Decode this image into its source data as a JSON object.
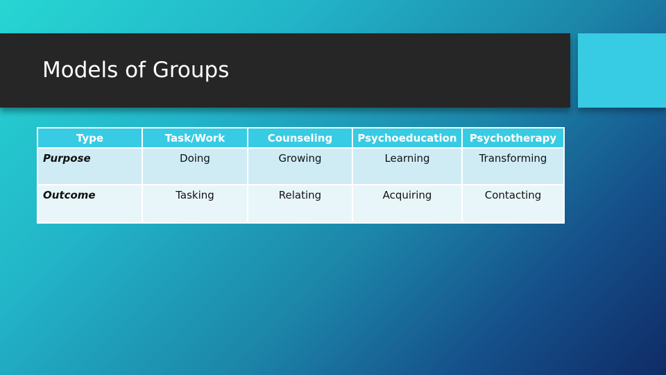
{
  "slide": {
    "title": "Models of Groups",
    "colors": {
      "title_bar": "#262626",
      "accent": "#38cbe4",
      "row_odd": "#cfecf5",
      "row_even": "#e8f6fa"
    }
  },
  "table": {
    "headers": [
      "Type",
      "Task/Work",
      "Counseling",
      "Psychoeducation",
      "Psychotherapy"
    ],
    "rows": [
      {
        "label": "Purpose",
        "cells": [
          "Doing",
          "Growing",
          "Learning",
          "Transforming"
        ]
      },
      {
        "label": "Outcome",
        "cells": [
          "Tasking",
          "Relating",
          "Acquiring",
          "Contacting"
        ]
      }
    ]
  }
}
